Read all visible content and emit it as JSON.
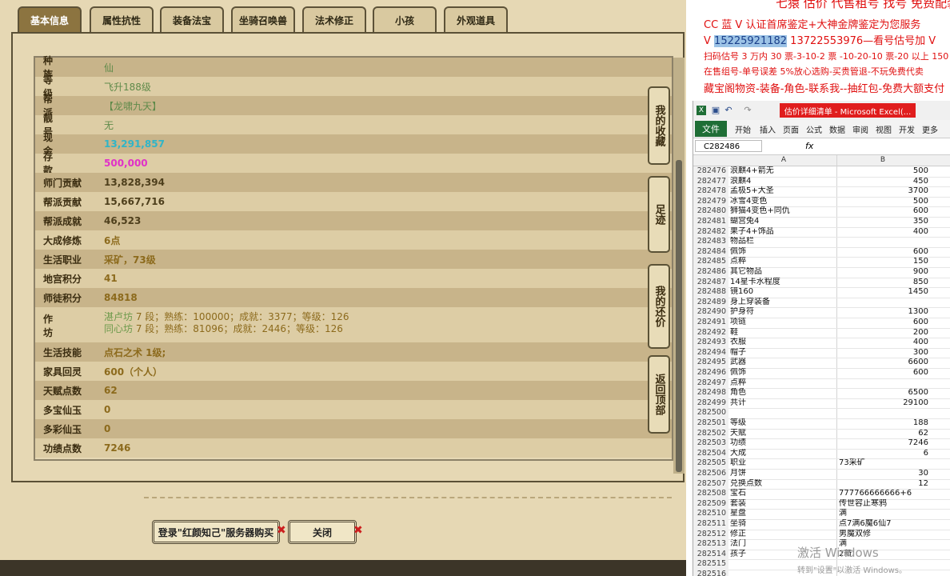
{
  "tabs": [
    {
      "label": "基本信息",
      "active": true
    },
    {
      "label": "属性抗性"
    },
    {
      "label": "装备法宝"
    },
    {
      "label": "坐骑召唤兽"
    },
    {
      "label": "法术修正"
    },
    {
      "label": "小孩"
    },
    {
      "label": "外观道具"
    }
  ],
  "info": {
    "race": {
      "label": "种 族",
      "value": "仙"
    },
    "level": {
      "label": "等 级",
      "value": "飞升188级"
    },
    "guild": {
      "label": "帮 派",
      "value": "【龙啸九天】"
    },
    "vip": {
      "label": "靓 号",
      "value": "无"
    },
    "cash": {
      "label": "现 金",
      "value": "13,291,857"
    },
    "deposit": {
      "label": "存 款",
      "value": "500,000"
    },
    "master_contrib": {
      "label": "师门贡献",
      "value": "13,828,394"
    },
    "guild_contrib": {
      "label": "帮派贡献",
      "value": "15,667,716"
    },
    "guild_achieve": {
      "label": "帮派成就",
      "value": "46,523"
    },
    "cultivation": {
      "label": "大成修炼",
      "value": "6点"
    },
    "life_job": {
      "label": "生活职业",
      "value": "采矿，73级"
    },
    "palace_points": {
      "label": "地宫积分",
      "value": "41"
    },
    "mentor_points": {
      "label": "师徒积分",
      "value": "84818"
    },
    "workshop": {
      "label": "作 坊",
      "line1_name": "湛卢坊",
      "line1_rest": "7 段；熟练：100000；成就：3377；等级：126",
      "line2_name": "同心坊",
      "line2_rest": "7 段；熟练：81096；成就：2446；等级：126"
    },
    "life_skill": {
      "label": "生活技能",
      "value": "点石之术 1级;"
    },
    "home_jade": {
      "label": "家具回灵",
      "value": "600（个人）"
    },
    "talent": {
      "label": "天赋点数",
      "value": "62"
    },
    "duobao": {
      "label": "多宝仙玉",
      "value": "0"
    },
    "duocai": {
      "label": "多彩仙玉",
      "value": "0"
    },
    "merit": {
      "label": "功绩点数",
      "value": "7246"
    }
  },
  "side_buttons": [
    {
      "label": "我的收藏"
    },
    {
      "label": "足迹"
    },
    {
      "label": "我的还价"
    },
    {
      "label": "返回顶部"
    }
  ],
  "bottom_buttons": {
    "login": "登录\"红颜知己\"服务器购买",
    "close": "关闭"
  },
  "notes": {
    "top": "七猿 估价 代售租号 找号 免费配装",
    "l1": "CC 蓝 V 认证首席鉴定+大神金牌鉴定为您服务",
    "l2a": "V",
    "l2b": "15225921182",
    "l2c": "13722553976—看号估号加 V",
    "l3": "扫码估号 3 万内 30 票-3-10-2 票 -10-20-10 票-20 以上 150",
    "l4": "在售组号-单号误差 5%放心选购-买贵管退-不玩免费代卖",
    "l5": "藏宝阁物资-装备-角色-联系我--抽红包-免费大额支付"
  },
  "excel": {
    "window_title": "估价详细清单 - Microsoft Excel(...",
    "ribbon_tabs": [
      "开始",
      "插入",
      "页面",
      "公式",
      "数据",
      "审阅",
      "视图",
      "开发",
      "更多"
    ],
    "file_tab": "文件",
    "name_box": "C282486",
    "fx": "fx",
    "col_a": "A",
    "col_b": "B",
    "rows": [
      {
        "n": "282476",
        "a": "浪麒4+箭无",
        "b": "500"
      },
      {
        "n": "282477",
        "a": "浪麒4",
        "b": "450"
      },
      {
        "n": "282478",
        "a": "孟极5+大圣",
        "b": "3700"
      },
      {
        "n": "282479",
        "a": "冰雪4变色",
        "b": "500"
      },
      {
        "n": "282480",
        "a": "狮猫4变色+同仇",
        "b": "600"
      },
      {
        "n": "282481",
        "a": "蝴宫兔4",
        "b": "350"
      },
      {
        "n": "282482",
        "a": "果子4+饰品",
        "b": "400"
      },
      {
        "n": "282483",
        "a": "物品栏",
        "b": ""
      },
      {
        "n": "282484",
        "a": "佩饰",
        "b": "600"
      },
      {
        "n": "282485",
        "a": "点粹",
        "b": "150"
      },
      {
        "n": "282486",
        "a": "其它物品",
        "b": "900"
      },
      {
        "n": "282487",
        "a": "14星卡水程度",
        "b": "850"
      },
      {
        "n": "282488",
        "a": "镜160",
        "b": "1450"
      },
      {
        "n": "282489",
        "a": "身上穿装备",
        "b": ""
      },
      {
        "n": "282490",
        "a": "护身符",
        "b": "1300"
      },
      {
        "n": "282491",
        "a": "项链",
        "b": "600"
      },
      {
        "n": "282492",
        "a": "鞋",
        "b": "200"
      },
      {
        "n": "282493",
        "a": "衣服",
        "b": "400"
      },
      {
        "n": "282494",
        "a": "帽子",
        "b": "300"
      },
      {
        "n": "282495",
        "a": "武器",
        "b": "6600"
      },
      {
        "n": "282496",
        "a": "佩饰",
        "b": "600"
      },
      {
        "n": "282497",
        "a": "点粹",
        "b": ""
      },
      {
        "n": "282498",
        "a": "角色",
        "b": "6500"
      },
      {
        "n": "282499",
        "a": "共计",
        "b": "29100"
      },
      {
        "n": "282500",
        "a": "",
        "b": ""
      },
      {
        "n": "282501",
        "a": "等级",
        "b": "188"
      },
      {
        "n": "282502",
        "a": "天赋",
        "b": "62"
      },
      {
        "n": "282503",
        "a": "功绩",
        "b": "7246"
      },
      {
        "n": "282504",
        "a": "大成",
        "b": "6"
      },
      {
        "n": "282505",
        "a": "职业",
        "b": "73采矿",
        "text": true
      },
      {
        "n": "282506",
        "a": "月饼",
        "b": "30"
      },
      {
        "n": "282507",
        "a": "兑换点数",
        "b": "12"
      },
      {
        "n": "282508",
        "a": "宝石",
        "b": "777766666666+6",
        "text": true
      },
      {
        "n": "282509",
        "a": "套装",
        "b": "传世容止寒鸦",
        "text": true
      },
      {
        "n": "282510",
        "a": "星盘",
        "b": "满",
        "text": true
      },
      {
        "n": "282511",
        "a": "坐骑",
        "b": "点7满6魔6仙7",
        "text": true
      },
      {
        "n": "282512",
        "a": "修正",
        "b": "男魔双修",
        "text": true
      },
      {
        "n": "282513",
        "a": "法门",
        "b": "满",
        "text": true
      },
      {
        "n": "282514",
        "a": "孩子",
        "b": "2新",
        "text": true
      },
      {
        "n": "282515",
        "a": "",
        "b": ""
      },
      {
        "n": "282516",
        "a": "",
        "b": ""
      }
    ],
    "watermark1": "激活 Windows",
    "watermark2": "转到\"设置\"以激活 Windows。"
  }
}
